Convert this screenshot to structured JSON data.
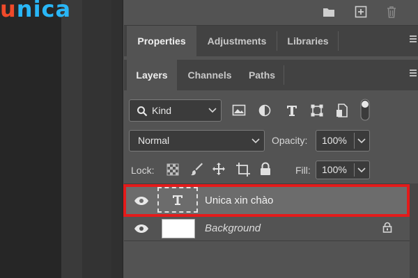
{
  "brand": {
    "logo_first": "u",
    "logo_rest": "nica"
  },
  "top_icons": [
    "folder-icon",
    "new-layer-icon",
    "trash-icon"
  ],
  "panel_tabs": [
    {
      "label": "Properties",
      "active": true
    },
    {
      "label": "Adjustments",
      "active": false
    },
    {
      "label": "Libraries",
      "active": false
    }
  ],
  "layer_tabs": [
    {
      "label": "Layers",
      "active": true
    },
    {
      "label": "Channels",
      "active": false
    },
    {
      "label": "Paths",
      "active": false
    }
  ],
  "filter": {
    "kind_label": "Kind"
  },
  "blend": {
    "mode": "Normal",
    "opacity_label": "Opacity:",
    "opacity_value": "100%"
  },
  "lock": {
    "lock_label": "Lock:",
    "fill_label": "Fill:",
    "fill_value": "100%"
  },
  "layers": [
    {
      "name": "Unica xin chào",
      "type": "text",
      "selected": true
    },
    {
      "name": "Background",
      "type": "image",
      "italic": true,
      "locked": true
    }
  ],
  "colors": {
    "highlight": "#e31b1b",
    "logo_orange": "#f04a2a",
    "logo_blue": "#29b6f6"
  }
}
